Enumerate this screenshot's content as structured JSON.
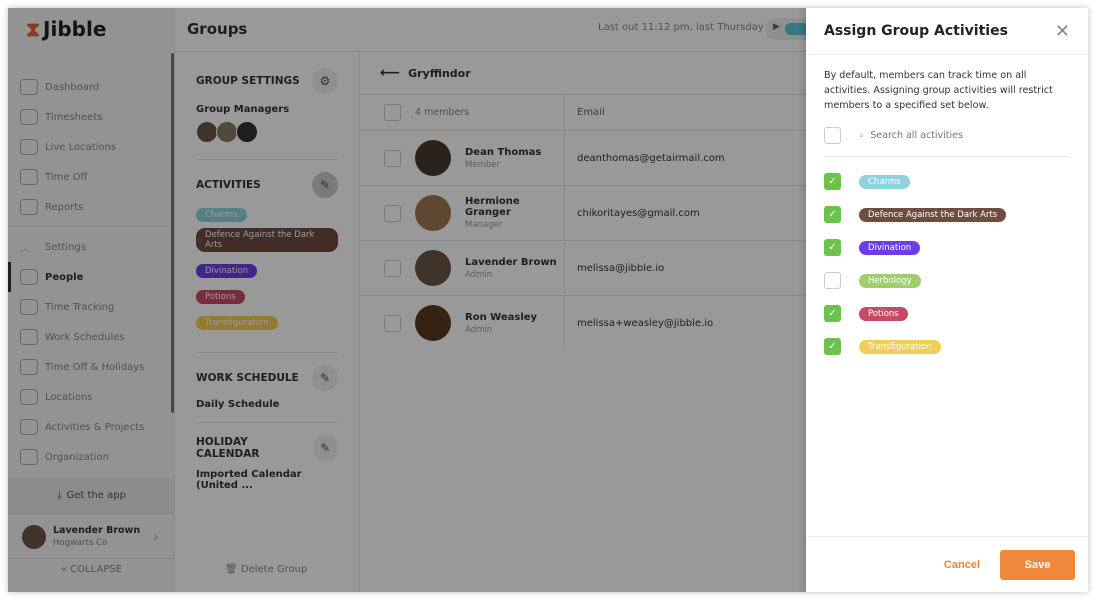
{
  "app": {
    "name": "Jibble",
    "page_title": "Groups",
    "last_out": "Last out 11:12 pm, last Thursday"
  },
  "sidebar": {
    "top_items": [
      {
        "label": "Dashboard",
        "icon": "dashboard-icon"
      },
      {
        "label": "Timesheets",
        "icon": "clock-icon"
      },
      {
        "label": "Live Locations",
        "icon": "location-pin-icon"
      },
      {
        "label": "Time Off",
        "icon": "briefcase-icon"
      },
      {
        "label": "Reports",
        "icon": "clipboard-icon"
      }
    ],
    "settings_label": "Settings",
    "settings_items": [
      {
        "label": "People",
        "icon": "people-icon",
        "active": true
      },
      {
        "label": "Time Tracking",
        "icon": "time-tracking-icon"
      },
      {
        "label": "Work Schedules",
        "icon": "schedule-icon"
      },
      {
        "label": "Time Off & Holidays",
        "icon": "briefcase-icon"
      },
      {
        "label": "Locations",
        "icon": "location-pin-icon"
      },
      {
        "label": "Activities & Projects",
        "icon": "tag-icon"
      },
      {
        "label": "Organization",
        "icon": "gear-icon"
      }
    ],
    "get_app": "Get the app",
    "user": {
      "name": "Lavender Brown",
      "org": "Hogwarts Co"
    },
    "collapse": "COLLAPSE"
  },
  "group_settings": {
    "heading": "GROUP SETTINGS",
    "managers_label": "Group Managers",
    "activities_heading": "ACTIVITIES",
    "activities": [
      {
        "label": "Charms",
        "color": "#8fd3df"
      },
      {
        "label": "Defence Against the Dark Arts",
        "color": "#6e4c40"
      },
      {
        "label": "Divination",
        "color": "#6d3ee6"
      },
      {
        "label": "Potions",
        "color": "#c64a64"
      },
      {
        "label": "Transfiguration",
        "color": "#f2cf53"
      }
    ],
    "work_schedule_heading": "WORK SCHEDULE",
    "work_schedule": "Daily Schedule",
    "holiday_heading": "HOLIDAY CALENDAR",
    "holiday": "Imported Calendar (United ...",
    "delete": "Delete Group"
  },
  "members": {
    "group_name": "Gryffindor",
    "count_label": "4 members",
    "email_header": "Email",
    "rows": [
      {
        "name": "Dean Thomas",
        "role": "Member",
        "email": "deanthomas@getairmail.com"
      },
      {
        "name": "Hermione Granger",
        "role": "Manager",
        "email": "chikoritayes@gmail.com"
      },
      {
        "name": "Lavender Brown",
        "role": "Admin",
        "email": "melissa@jibble.io"
      },
      {
        "name": "Ron Weasley",
        "role": "Admin",
        "email": "melissa+weasley@jibble.io"
      }
    ]
  },
  "panel": {
    "title": "Assign Group Activities",
    "description": "By default, members can track time on all activities. Assigning group activities will restrict members to a specified set below.",
    "search_placeholder": "Search all activities",
    "activities": [
      {
        "label": "Charms",
        "color": "#8fd3df",
        "checked": true
      },
      {
        "label": "Defence Against the Dark Arts",
        "color": "#6e4c40",
        "checked": true
      },
      {
        "label": "Divination",
        "color": "#6d3ee6",
        "checked": true
      },
      {
        "label": "Herbology",
        "color": "#9fcf6a",
        "checked": false
      },
      {
        "label": "Potions",
        "color": "#c64a64",
        "checked": true
      },
      {
        "label": "Transfiguration",
        "color": "#f2cf53",
        "checked": true
      }
    ],
    "cancel": "Cancel",
    "save": "Save"
  }
}
